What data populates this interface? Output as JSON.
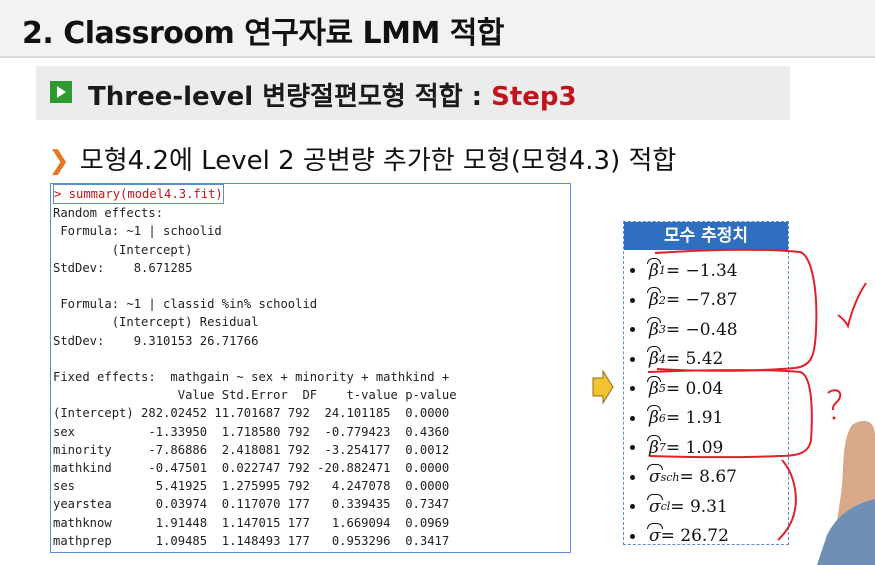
{
  "title": "2. Classroom 연구자료 LMM 적합",
  "subtitle": {
    "main": "Three-level 변량절편모형 적합 : ",
    "step": "Step3"
  },
  "bullet": "모형4.2에 Level 2 공변량 추가한 모형(모형4.3) 적합",
  "console": {
    "prompt": "> summary(model4.3.fit)",
    "lines": [
      "Random effects:",
      " Formula: ~1 | schoolid",
      "        (Intercept)",
      "StdDev:    8.671285",
      "",
      " Formula: ~1 | classid %in% schoolid",
      "        (Intercept) Residual",
      "StdDev:    9.310153 26.71766",
      "",
      "Fixed effects:  mathgain ~ sex + minority + mathkind +",
      "                 Value Std.Error  DF    t-value p-value",
      "(Intercept) 282.02452 11.701687 792  24.101185  0.0000",
      "sex          -1.33950  1.718580 792  -0.779423  0.4360",
      "minority     -7.86886  2.418081 792  -3.254177  0.0012",
      "mathkind     -0.47501  0.022747 792 -20.882471  0.0000",
      "ses           5.41925  1.275995 792   4.247078  0.0000",
      "yearstea      0.03974  0.117070 177   0.339435  0.7347",
      "mathknow      1.91448  1.147015 177   1.669094  0.0969",
      "mathprep      1.09485  1.148493 177   0.953296  0.3417"
    ]
  },
  "params": {
    "header": "모수 추정치",
    "items": [
      {
        "sym": "β",
        "sub": "1",
        "hat": true,
        "value": " = −1.34"
      },
      {
        "sym": "β",
        "sub": "2",
        "hat": true,
        "value": " = −7.87"
      },
      {
        "sym": "β",
        "sub": "3",
        "hat": true,
        "value": " = −0.48"
      },
      {
        "sym": "β",
        "sub": "4",
        "hat": true,
        "value": " = 5.42"
      },
      {
        "sym": "β",
        "sub": "5",
        "hat": true,
        "value": " = 0.04"
      },
      {
        "sym": "β",
        "sub": "6",
        "hat": true,
        "value": " = 1.91"
      },
      {
        "sym": "β",
        "sub": "7",
        "hat": true,
        "value": " = 1.09"
      },
      {
        "sym": "σ",
        "sub": "sch",
        "hat": true,
        "value": " = 8.67"
      },
      {
        "sym": "σ",
        "sub": "cl",
        "hat": true,
        "value": " = 9.31"
      },
      {
        "sym": "σ",
        "sub": "",
        "hat": true,
        "value": " = 26.72"
      }
    ]
  },
  "colors": {
    "accent_blue": "#2e6fbf",
    "step_red": "#c0141c",
    "icon_green": "#2f9a2f",
    "bullet_orange": "#e87722",
    "arrow_yellow": "#f2c230",
    "annotation_red": "#e0202a"
  },
  "icons": {
    "sub_icon": "play-square-icon",
    "bullet_icon": "chevron-right-icon",
    "arrow_icon": "right-arrow-icon"
  }
}
